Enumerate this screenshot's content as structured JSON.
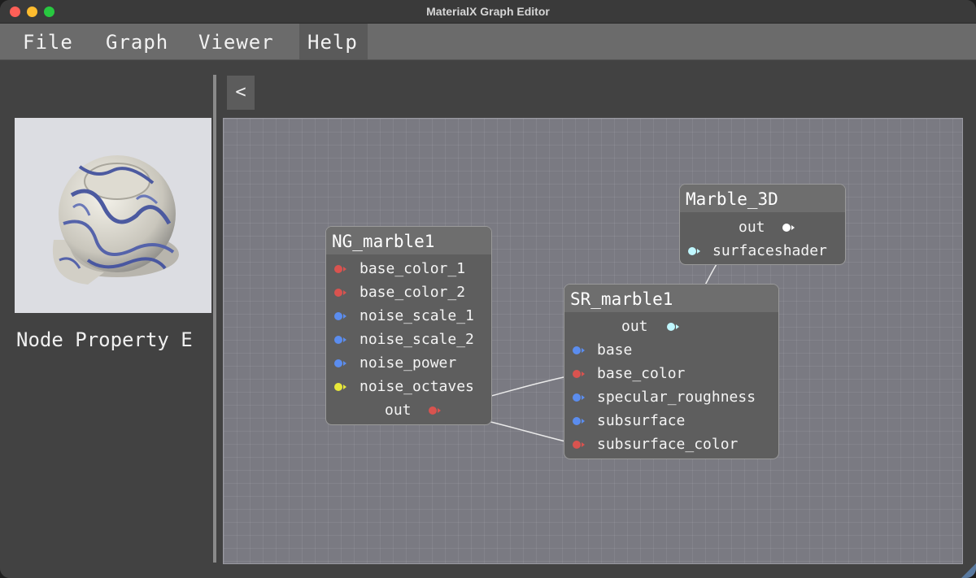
{
  "window": {
    "title": "MaterialX Graph Editor"
  },
  "menu": {
    "file": "File",
    "graph": "Graph",
    "viewer": "Viewer",
    "help": "Help"
  },
  "left_panel": {
    "title": "Node Property E"
  },
  "graph": {
    "collapse_label": "<",
    "nodes": {
      "ng_marble": {
        "title": "NG_marble1",
        "inputs": [
          "base_color_1",
          "base_color_2",
          "noise_scale_1",
          "noise_scale_2",
          "noise_power",
          "noise_octaves"
        ],
        "output": "out"
      },
      "sr_marble": {
        "title": "SR_marble1",
        "output": "out",
        "inputs": [
          "base",
          "base_color",
          "specular_roughness",
          "subsurface",
          "subsurface_color"
        ]
      },
      "marble_3d": {
        "title": "Marble_3D",
        "output": "out",
        "inputs": [
          "surfaceshader"
        ]
      }
    }
  },
  "colors": {
    "color3_pin": "#d9534f",
    "float_pin": "#5b8def",
    "integer_pin": "#e8e83a",
    "surfaceshader_pin": "#bff7ff",
    "material_pin": "#ffffff"
  }
}
